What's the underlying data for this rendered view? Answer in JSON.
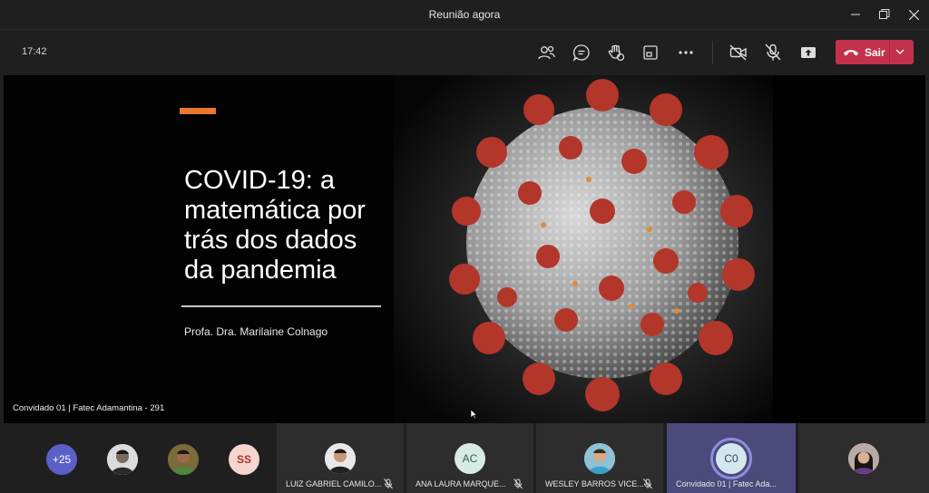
{
  "window": {
    "title": "Reunião agora"
  },
  "toolbar": {
    "clock": "17:42",
    "leave_label": "Sair"
  },
  "slide": {
    "title_lines": [
      "COVID-19: a",
      "matemática por",
      "trás dos dados",
      "da pandemia"
    ],
    "author": "Profa. Dra. Marilaine Colnago",
    "presenter_label": "Convidado 01 | Fatec Adamantina - 291"
  },
  "participants": {
    "overflow_count": "+25",
    "small_avatars": [
      {
        "kind": "photo"
      },
      {
        "kind": "photo"
      },
      {
        "initials": "SS"
      }
    ],
    "tiles": [
      {
        "name": "LUIZ GABRIEL CAMILO...",
        "kind": "photo",
        "muted": true
      },
      {
        "name": "ANA LAURA MARQUE...",
        "initials": "AC",
        "muted": true
      },
      {
        "name": "WESLEY BARROS VICE...",
        "kind": "photo",
        "muted": true
      },
      {
        "name": "Convidado 01 | Fatec Ada...",
        "initials": "C0",
        "muted": false,
        "speaking": true
      },
      {
        "name": "",
        "kind": "photo",
        "muted": false
      }
    ]
  },
  "colors": {
    "leave": "#c4314b",
    "accent": "#e8772e",
    "speaking_ring": "#8f8dde",
    "overflow_badge": "#5b5fc7"
  }
}
